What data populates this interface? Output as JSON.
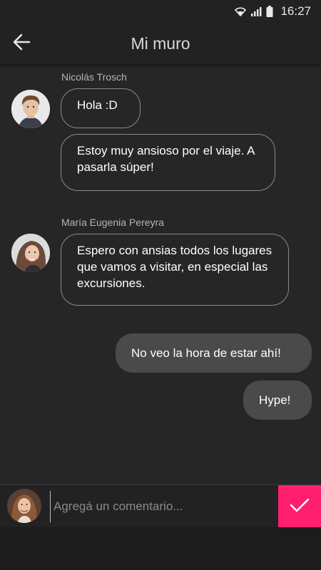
{
  "status_bar": {
    "time": "16:27",
    "icons": [
      "wifi-icon",
      "signal-icon",
      "battery-icon"
    ]
  },
  "app_bar": {
    "title": "Mi muro",
    "back_icon": "arrow-left-icon"
  },
  "messages": [
    {
      "sender": "Nicolás Trosch",
      "direction": "incoming",
      "bubbles": [
        "Hola :D",
        "Estoy muy ansioso por el viaje. A pasarla súper!"
      ]
    },
    {
      "sender": "María Eugenia Pereyra",
      "direction": "incoming",
      "bubbles": [
        "Espero con ansias todos los lugares que vamos a visitar, en especial las excursiones."
      ]
    },
    {
      "sender": "",
      "direction": "outgoing",
      "bubbles": [
        "No veo la hora de estar ahí!",
        "Hype!"
      ]
    }
  ],
  "composer": {
    "placeholder": "Agregá un comentario...",
    "value": "",
    "send_icon": "checkmark-icon"
  },
  "colors": {
    "accent": "#ff1f6e",
    "background": "#262626",
    "bar": "#222222",
    "outgoing_bubble": "#4a4a4a",
    "incoming_border": "#8a8a8a"
  }
}
